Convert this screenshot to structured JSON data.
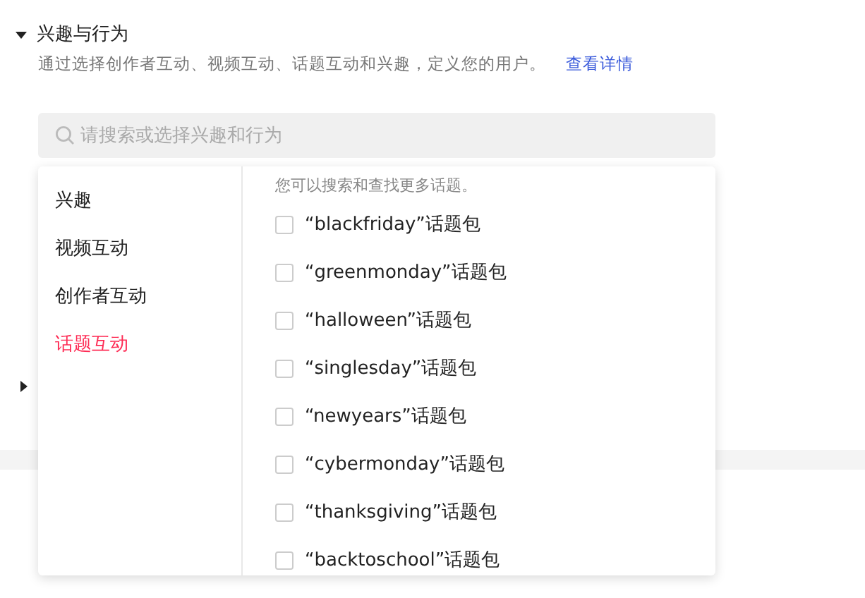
{
  "section": {
    "title": "兴趣与行为",
    "expanded": true,
    "description": "通过选择创作者互动、视频互动、话题互动和兴趣，定义您的用户。",
    "link": "查看详情"
  },
  "search": {
    "placeholder": "请搜索或选择兴趣和行为"
  },
  "dropdown": {
    "categories": [
      {
        "label": "兴趣",
        "selected": false
      },
      {
        "label": "视频互动",
        "selected": false
      },
      {
        "label": "创作者互动",
        "selected": false
      },
      {
        "label": "话题互动",
        "selected": true
      }
    ],
    "hint": "您可以搜索和查找更多话题。",
    "options": [
      {
        "label": "“blackfriday”话题包",
        "checked": false
      },
      {
        "label": "“greenmonday”话题包",
        "checked": false
      },
      {
        "label": "“halloween”话题包",
        "checked": false
      },
      {
        "label": "“singlesday”话题包",
        "checked": false
      },
      {
        "label": "“newyears”话题包",
        "checked": false
      },
      {
        "label": "“cybermonday”话题包",
        "checked": false
      },
      {
        "label": "“thanksgiving”话题包",
        "checked": false
      },
      {
        "label": "“backtoschool”话题包",
        "checked": false
      }
    ]
  },
  "next_section": {
    "expanded": false
  }
}
